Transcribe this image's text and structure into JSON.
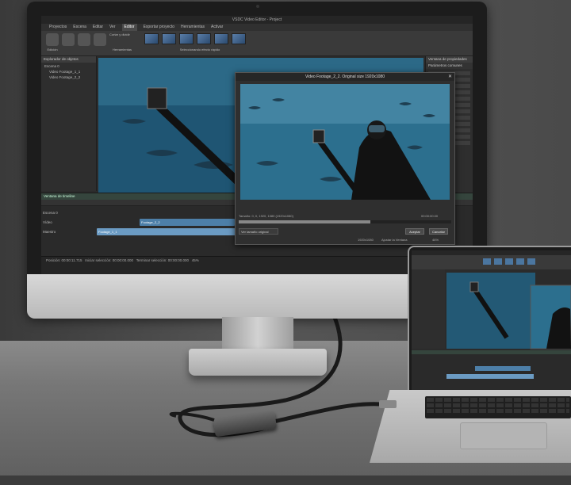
{
  "monitor_app": {
    "title": "VSDC Video Editor - Project",
    "menu": [
      "Proyectos",
      "Escena",
      "Editar",
      "Ver",
      "Editor",
      "Exportar proyecto",
      "Herramientas",
      "Activar"
    ],
    "active_menu": "Editor",
    "ribbon_groups": [
      "Edición",
      "Herramientas",
      "Seleccionando efecto rápido"
    ],
    "ribbon_label_crop": "Cortar y dividir",
    "explorer_title": "Explorador de objetos",
    "explorer_items": [
      "Escena 0",
      "Video Footage_1_1",
      "Video Footage_2_2"
    ],
    "properties_title": "Ventana de propiedades",
    "properties_subtitle": "Parámetros comunes",
    "timeline_title": "Ventana de timeline",
    "timeline_scene": "Escena 0",
    "timeline_tracks": [
      {
        "label": "Vídeo",
        "clip": "Footage_2_2"
      },
      {
        "label": "Maestro",
        "clip": "Footage_1_1"
      }
    ],
    "status_position": "Posición: 00:00:11.715",
    "status_selection": "Iniciar selección: 00:00:00.000",
    "status_end": "Terminar selección: 00:00:00.000",
    "zoom": "45%"
  },
  "dialog": {
    "title": "Video Footage_2_2. Original size 1920x1080",
    "info": "Tamaño: 0, 0, 1920, 1080 (1920x1080)",
    "timecode": "00:00:00.00",
    "select_value": "Ver tamaño original",
    "ok": "Aceptar",
    "cancel": "Cancelar",
    "footer_size": "1920x1080",
    "footer_fit": "Ajustar la Ventana",
    "footer_zoom": "46%"
  },
  "colors": {
    "water": "#2c6f8e",
    "timeline_accent": "#35453d",
    "clip_video": "#4d7fa8",
    "clip_master": "#6b9bc3"
  }
}
